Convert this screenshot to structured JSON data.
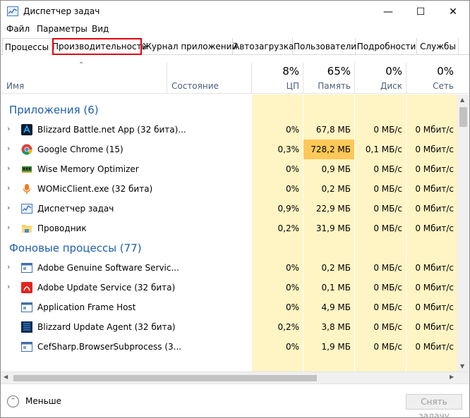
{
  "window": {
    "title": "Диспетчер задач",
    "icon": "task-manager-icon",
    "controls": {
      "minimize": "—",
      "maximize": "☐",
      "close": "✕"
    }
  },
  "menu": [
    "Файл",
    "Параметры",
    "Вид"
  ],
  "tabs": [
    {
      "label": "Процессы",
      "active": true
    },
    {
      "label": "Производительность",
      "highlighted": true
    },
    {
      "label": "Журнал приложений"
    },
    {
      "label": "Автозагрузка"
    },
    {
      "label": "Пользователи"
    },
    {
      "label": "Подробности"
    },
    {
      "label": "Службы"
    }
  ],
  "columns": {
    "name": "Имя",
    "status": "Состояние",
    "cpu": {
      "percent": "8%",
      "label": "ЦП"
    },
    "memory": {
      "percent": "65%",
      "label": "Память"
    },
    "disk": {
      "percent": "0%",
      "label": "Диск"
    },
    "network": {
      "percent": "0%",
      "label": "Сеть"
    }
  },
  "groups": {
    "apps": "Приложения (6)",
    "background": "Фоновые процессы (77)"
  },
  "apps": [
    {
      "name": "Blizzard Battle.net App (32 бита)...",
      "cpu": "0%",
      "memory": "67,8 МБ",
      "disk": "0 МБ/с",
      "network": "0 Мбит/с",
      "icon": "battlenet-icon",
      "expandable": true
    },
    {
      "name": "Google Chrome (15)",
      "cpu": "0,3%",
      "memory": "728,2 МБ",
      "disk": "0,1 МБ/с",
      "network": "0 Мбит/с",
      "icon": "chrome-icon",
      "expandable": true,
      "memory_hot": true
    },
    {
      "name": "Wise Memory Optimizer",
      "cpu": "0%",
      "memory": "0,9 МБ",
      "disk": "0 МБ/с",
      "network": "0 Мбит/с",
      "icon": "memory-chip-icon",
      "expandable": true
    },
    {
      "name": "WOMicClient.exe (32 бита)",
      "cpu": "0%",
      "memory": "0,2 МБ",
      "disk": "0 МБ/с",
      "network": "0 Мбит/с",
      "icon": "microphone-icon",
      "expandable": true
    },
    {
      "name": "Диспетчер задач",
      "cpu": "0,9%",
      "memory": "22,9 МБ",
      "disk": "0 МБ/с",
      "network": "0 Мбит/с",
      "icon": "task-manager-icon",
      "expandable": true
    },
    {
      "name": "Проводник",
      "cpu": "0,2%",
      "memory": "31,9 МБ",
      "disk": "0 МБ/с",
      "network": "0 Мбит/с",
      "icon": "folder-icon",
      "expandable": true
    }
  ],
  "background": [
    {
      "name": "Adobe Genuine Software Servic...",
      "cpu": "0%",
      "memory": "0,2 МБ",
      "disk": "0 МБ/с",
      "network": "0 Мбит/с",
      "icon": "service-window-icon",
      "expandable": true
    },
    {
      "name": "Adobe Update Service (32 бита)",
      "cpu": "0%",
      "memory": "0,1 МБ",
      "disk": "0 МБ/с",
      "network": "0 Мбит/с",
      "icon": "adobe-icon",
      "expandable": true
    },
    {
      "name": "Application Frame Host",
      "cpu": "0%",
      "memory": "4,9 МБ",
      "disk": "0 МБ/с",
      "network": "0 Мбит/с",
      "icon": "service-window-icon",
      "expandable": false
    },
    {
      "name": "Blizzard Update Agent (32 бита)",
      "cpu": "0,2%",
      "memory": "3,8 МБ",
      "disk": "0 МБ/с",
      "network": "0 Мбит/с",
      "icon": "blizzard-agent-icon",
      "expandable": false
    },
    {
      "name": "CefSharp.BrowserSubprocess (3...",
      "cpu": "0%",
      "memory": "1,9 МБ",
      "disk": "0 МБ/с",
      "network": "0 Мбит/с",
      "icon": "service-window-icon",
      "expandable": false
    }
  ],
  "footer": {
    "less": "Меньше",
    "end_task": "Снять задачу"
  },
  "colors": {
    "accent": "#1e5eb0",
    "heat_light": "#fff4c4",
    "heat_hot": "#fec859",
    "highlight": "#e0000f"
  }
}
